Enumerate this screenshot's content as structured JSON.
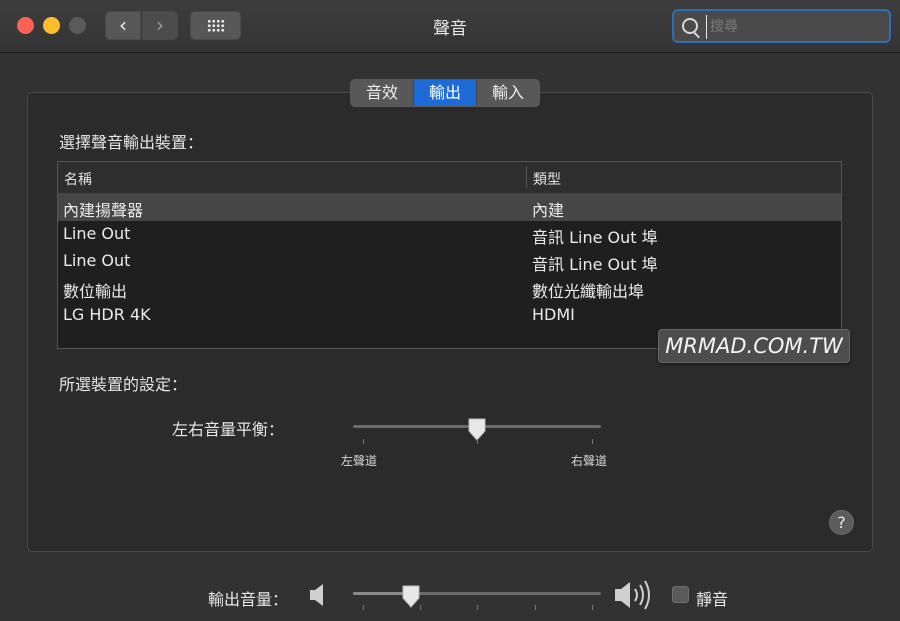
{
  "window": {
    "title": "聲音",
    "search_placeholder": "搜尋",
    "search_value": ""
  },
  "nav": {
    "back_glyph": "‹",
    "forward_glyph": "›"
  },
  "tabs": [
    {
      "label": "音效",
      "active": false
    },
    {
      "label": "輸出",
      "active": true
    },
    {
      "label": "輸入",
      "active": false
    }
  ],
  "output": {
    "section_title": "選擇聲音輸出裝置：",
    "columns": [
      "名稱",
      "類型"
    ],
    "rows": [
      {
        "name": "內建揚聲器",
        "type": "內建",
        "selected": true
      },
      {
        "name": "Line Out",
        "type": "音訊 Line Out 埠",
        "selected": false
      },
      {
        "name": "Line Out",
        "type": "音訊 Line Out 埠",
        "selected": false
      },
      {
        "name": "數位輸出",
        "type": "數位光纖輸出埠",
        "selected": false
      },
      {
        "name": "LG HDR 4K",
        "type": "HDMI",
        "selected": false
      }
    ]
  },
  "settings": {
    "section_title": "所選裝置的設定：",
    "balance_label": "左右音量平衡：",
    "balance_left": "左聲道",
    "balance_right": "右聲道",
    "balance_value": 0.5
  },
  "watermark": "MRMAD.COM.TW",
  "help_glyph": "?",
  "volume": {
    "label": "輸出音量：",
    "value": 0.21,
    "mute_label": "靜音",
    "muted": false
  },
  "icons": [
    "search-icon",
    "speaker-low-icon",
    "speaker-high-icon",
    "grid-icon",
    "help-icon"
  ]
}
